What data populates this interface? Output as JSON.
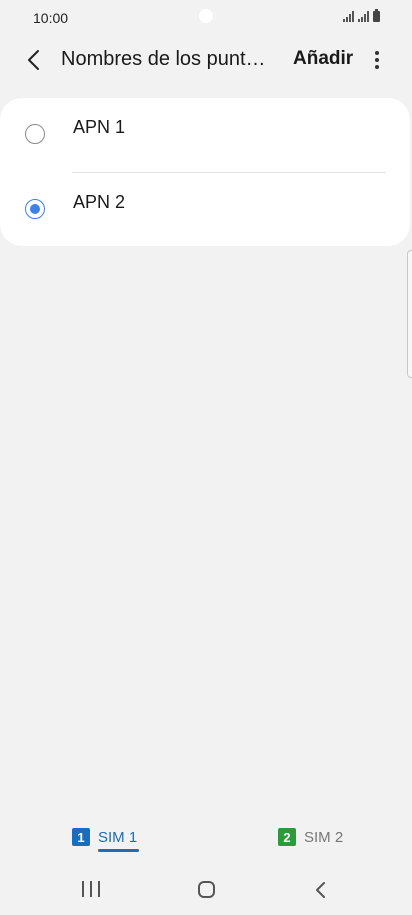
{
  "status_bar": {
    "time": "10:00"
  },
  "app_bar": {
    "title": "Nombres de los punto…",
    "add_label": "Añadir"
  },
  "apn_list": [
    {
      "label": "APN 1",
      "selected": false
    },
    {
      "label": "APN 2",
      "selected": true
    }
  ],
  "sim_tabs": [
    {
      "badge": "1",
      "label": "SIM 1",
      "active": true,
      "color": "#1b6db8"
    },
    {
      "badge": "2",
      "label": "SIM 2",
      "active": false,
      "color": "#2e9a3e"
    }
  ],
  "icons": {
    "back": "chevron-left-icon",
    "more": "more-vertical-icon",
    "nav_recents": "recents-icon",
    "nav_home": "home-icon",
    "nav_back": "back-icon"
  },
  "colors": {
    "accent": "#3c82e6",
    "sim1": "#1b6db8",
    "sim2": "#2e9a3e",
    "background": "#f2f2f2"
  }
}
